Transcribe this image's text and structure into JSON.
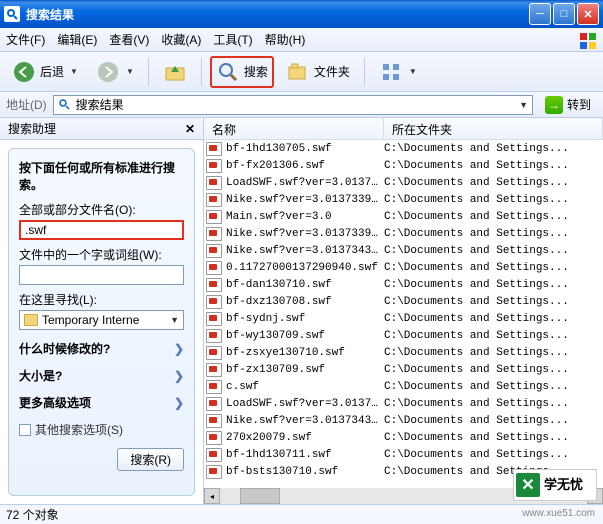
{
  "window": {
    "title": "搜索结果"
  },
  "menu": {
    "file": "文件(F)",
    "edit": "编辑(E)",
    "view": "查看(V)",
    "fav": "收藏(A)",
    "tools": "工具(T)",
    "help": "帮助(H)"
  },
  "toolbar": {
    "back": "后退",
    "search": "搜索",
    "folders": "文件夹"
  },
  "address": {
    "label": "地址(D)",
    "value": "搜索结果",
    "go": "转到"
  },
  "sidebar": {
    "title": "搜索助理",
    "heading": "按下面任何或所有标准进行搜索。",
    "fname_label": "全部或部分文件名(O):",
    "fname_value": ".swf",
    "phrase_label": "文件中的一个字或词组(W):",
    "phrase_value": "",
    "lookin_label": "在这里寻找(L):",
    "lookin_value": "Temporary Interne",
    "when": "什么时候修改的?",
    "size": "大小是?",
    "more": "更多高级选项",
    "other": "其他搜索选项(S)",
    "search_btn": "搜索(R)"
  },
  "columns": {
    "name": "名称",
    "folder": "所在文件夹"
  },
  "files": [
    {
      "name": "bf-1hd130705.swf",
      "loc": "C:\\Documents and Settings..."
    },
    {
      "name": "bf-fx201306.swf",
      "loc": "C:\\Documents and Settings..."
    },
    {
      "name": "LoadSWF.swf?ver=3.01373...",
      "loc": "C:\\Documents and Settings..."
    },
    {
      "name": "Nike.swf?ver=3.01373391...",
      "loc": "C:\\Documents and Settings..."
    },
    {
      "name": "Main.swf?ver=3.0",
      "loc": "C:\\Documents and Settings..."
    },
    {
      "name": "Nike.swf?ver=3.01373391...",
      "loc": "C:\\Documents and Settings..."
    },
    {
      "name": "Nike.swf?ver=3.01373430...",
      "loc": "C:\\Documents and Settings..."
    },
    {
      "name": "0.11727000137290940.swf",
      "loc": "C:\\Documents and Settings..."
    },
    {
      "name": "bf-dan130710.swf",
      "loc": "C:\\Documents and Settings..."
    },
    {
      "name": "bf-dxz130708.swf",
      "loc": "C:\\Documents and Settings..."
    },
    {
      "name": "bf-sydnj.swf",
      "loc": "C:\\Documents and Settings..."
    },
    {
      "name": "bf-wy130709.swf",
      "loc": "C:\\Documents and Settings..."
    },
    {
      "name": "bf-zsxye130710.swf",
      "loc": "C:\\Documents and Settings..."
    },
    {
      "name": "bf-zx130709.swf",
      "loc": "C:\\Documents and Settings..."
    },
    {
      "name": "c.swf",
      "loc": "C:\\Documents and Settings..."
    },
    {
      "name": "LoadSWF.swf?ver=3.01373...",
      "loc": "C:\\Documents and Settings..."
    },
    {
      "name": "Nike.swf?ver=3.01373437...",
      "loc": "C:\\Documents and Settings..."
    },
    {
      "name": "270x20079.swf",
      "loc": "C:\\Documents and Settings..."
    },
    {
      "name": "bf-1hd130711.swf",
      "loc": "C:\\Documents and Settings..."
    },
    {
      "name": "bf-bsts130710.swf",
      "loc": "C:\\Documents and Settings..."
    }
  ],
  "status": "72 个对象",
  "watermark": {
    "brand": "学无忧",
    "url": "www.xue51.com"
  }
}
